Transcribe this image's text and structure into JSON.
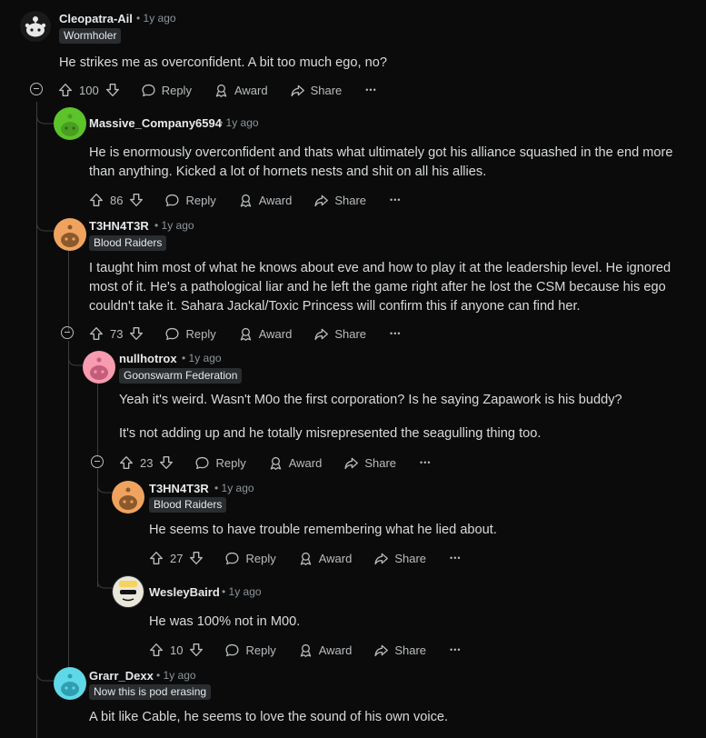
{
  "comments": [
    {
      "username": "Cleopatra-Ail",
      "age": "1y ago",
      "flair": "Wormholer",
      "body": [
        "He strikes me as overconfident. A bit too much ego, no?"
      ],
      "votes": "100"
    },
    {
      "username": "Massive_Company6594",
      "age": "1y ago",
      "flair": "",
      "body": [
        "He is enormously overconfident and thats what ultimately got his alliance squashed in the end more than anything. Kicked a lot of hornets nests and shit on all his allies."
      ],
      "votes": "86"
    },
    {
      "username": "T3HN4T3R",
      "age": "1y ago",
      "flair": "Blood Raiders",
      "body": [
        "I taught him most of what he knows about eve and how to play it at the leadership level. He ignored most of it. He's a pathological liar and he left the game right after he lost the CSM because his ego couldn't take it. Sahara Jackal/Toxic Princess will confirm this if anyone can find her."
      ],
      "votes": "73"
    },
    {
      "username": "nullhotrox",
      "age": "1y ago",
      "flair": "Goonswarm Federation",
      "body": [
        "Yeah it's weird. Wasn't M0o the first corporation? Is he saying Zapawork is his buddy?",
        "It's not adding up and he totally misrepresented the seagulling thing too."
      ],
      "votes": "23"
    },
    {
      "username": "T3HN4T3R",
      "age": "1y ago",
      "flair": "Blood Raiders",
      "body": [
        "He seems to have trouble remembering what he lied about."
      ],
      "votes": "27"
    },
    {
      "username": "WesleyBaird",
      "age": "1y ago",
      "flair": "",
      "body": [
        "He was 100% not in M00."
      ],
      "votes": "10"
    },
    {
      "username": "Grarr_Dexx",
      "age": "1y ago",
      "flair": "Now this is pod erasing",
      "body": [
        "A bit like Cable, he seems to love the sound of his own voice."
      ],
      "votes": ""
    }
  ],
  "labels": {
    "reply": "Reply",
    "award": "Award",
    "share": "Share",
    "dot": "•",
    "more": "•••"
  },
  "colors": {
    "background": "#0b0b0b",
    "thread_line": "#3a3e41",
    "flair_bg": "#2a2d30",
    "text": "#d7dadc",
    "muted": "#8b9499"
  },
  "icons": [
    "upvote-icon",
    "downvote-icon",
    "reply-icon",
    "award-icon",
    "share-icon",
    "more-icon",
    "collapse-icon",
    "snoo-avatar-icon"
  ]
}
